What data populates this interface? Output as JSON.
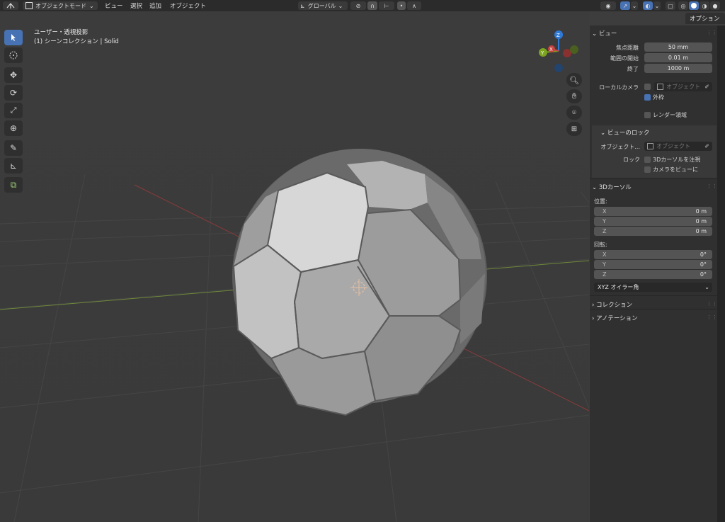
{
  "header": {
    "mode_label": "オブジェクトモード",
    "menus": [
      "ビュー",
      "選択",
      "追加",
      "オブジェクト"
    ],
    "transform_orientation": "グローバル"
  },
  "viewport": {
    "overlay_line1": "ユーザー・透視投影",
    "overlay_line2": "(1) シーンコレクション | Solid"
  },
  "gizmo": {
    "z": "Z",
    "y": "Y",
    "x": "X"
  },
  "sidebar": {
    "tab_label": "オプション",
    "view_panel": {
      "title": "ビュー",
      "focal_label": "焦点距離",
      "focal_value": "50 mm",
      "clip_start_label": "範囲の開始",
      "clip_start_value": "0.01 m",
      "clip_end_label": "終了",
      "clip_end_value": "1000 m",
      "local_camera_label": "ローカルカメラ",
      "object_placeholder": "オブジェクト",
      "outside_label": "外枠",
      "render_region_label": "レンダー領域"
    },
    "view_lock": {
      "title": "ビューのロック",
      "object_label": "オブジェクト...",
      "object_placeholder": "オブジェクト",
      "lock_label": "ロック",
      "lock_cursor_label": "3Dカーソルを注視",
      "camera_to_view_label": "カメラをビューに"
    },
    "cursor_panel": {
      "title": "3Dカーソル",
      "location_label": "位置:",
      "location": [
        {
          "axis": "X",
          "value": "0 m"
        },
        {
          "axis": "Y",
          "value": "0 m"
        },
        {
          "axis": "Z",
          "value": "0 m"
        }
      ],
      "rotation_label": "回転:",
      "rotation": [
        {
          "axis": "X",
          "value": "0°"
        },
        {
          "axis": "Y",
          "value": "0°"
        },
        {
          "axis": "Z",
          "value": "0°"
        }
      ],
      "rotation_mode": "XYZ オイラー角"
    },
    "collection_title": "コレクション",
    "annotation_title": "アノテーション"
  },
  "colors": {
    "accent": "#4772b3",
    "axis_x": "#c8423f",
    "axis_y": "#7ca41f",
    "axis_z": "#2f7ad6"
  }
}
